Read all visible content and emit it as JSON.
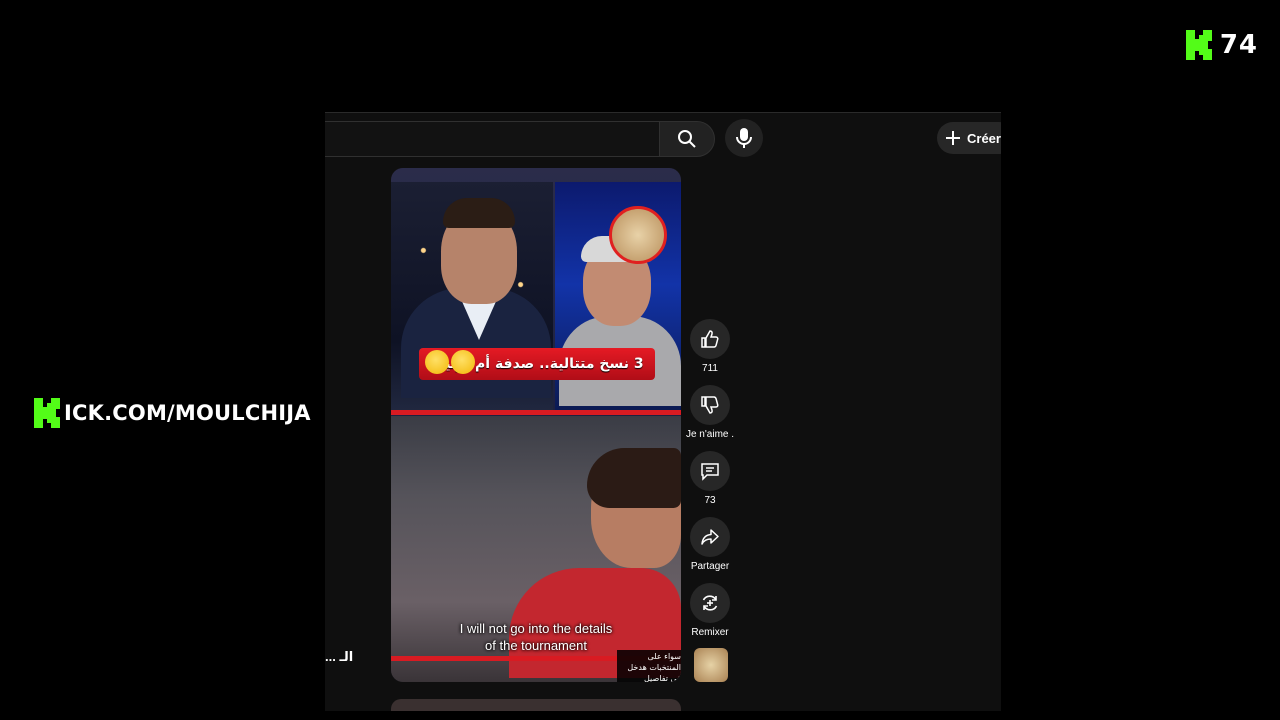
{
  "overlay": {
    "viewer_count": "74",
    "channel_url": "ICK.COM/MOULCHIJA",
    "brand_color": "#53fc18"
  },
  "browser": {
    "create_label": "Créer",
    "left_truncated": "... الـ"
  },
  "short": {
    "caption_text": "3 نسخ متتالية.. صدفة أم ترتيب",
    "subtitle_line1": "I will not go into the details",
    "subtitle_line2": "of the tournament",
    "arabic_note": "سواء على المنتخبات هدخل في تفاصيل"
  },
  "actions": {
    "like_count": "711",
    "dislike_label": "Je n'aime .",
    "comment_count": "73",
    "share_label": "Partager",
    "remix_label": "Remixer"
  },
  "icons": [
    "kick-logo-icon",
    "search-icon",
    "mic-icon",
    "plus-icon",
    "thumbs-up-icon",
    "thumbs-down-icon",
    "comment-icon",
    "share-icon",
    "remix-icon"
  ]
}
